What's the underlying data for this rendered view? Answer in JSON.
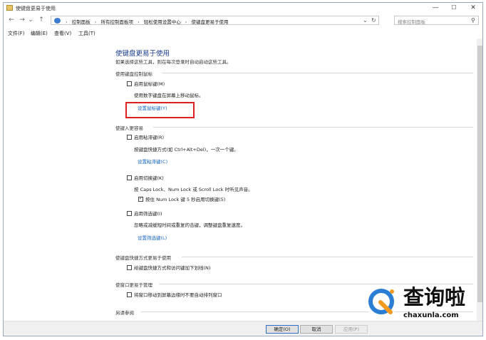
{
  "window": {
    "title": "使键盘更易于使用",
    "minimize_glyph": "—",
    "maximize_glyph": "☐",
    "close_glyph": "✕"
  },
  "nav": {
    "back_glyph": "←",
    "forward_glyph": "→",
    "recent_glyph": "⌄",
    "up_glyph": "↑",
    "breadcrumb": [
      "控制面板",
      "所有控制面板项",
      "轻松使用设置中心",
      "使键盘更易于使用"
    ],
    "crumb_sep": "›",
    "dropdown_glyph": "⌄",
    "refresh_glyph": "↻",
    "search_placeholder": "搜索控制面板",
    "search_glyph": "⚲"
  },
  "menu": [
    "文件(F)",
    "编辑(E)",
    "查看(V)",
    "工具(T)"
  ],
  "page": {
    "title": "使键盘更易于使用",
    "subtitle": "如果选择这些工具，则在每次登录时自动启动这些工具。",
    "mouse_section": {
      "header": "使用键盘控制鼠标",
      "mousekeys_label": "启用鼠标键(M)",
      "mousekeys_desc": "使用数字键盘在屏幕上移动鼠标。",
      "mousekeys_link": "设置鼠标键(Y)"
    },
    "typing_section": {
      "header": "使键入更容易",
      "sticky_label": "启用粘滞键(R)",
      "sticky_desc": "按键盘快捷方式(如 Ctrl+Alt+Del)，一次一个键。",
      "sticky_link": "设置粘滞键(C)",
      "toggle_label": "启用切换键(K)",
      "toggle_desc": "按 Caps Lock、Num Lock 或 Scroll Lock 时听见声音。",
      "toggle_sub_label": "按住 Num Lock 键 5 秒启用切换键(5)",
      "toggle_sub_checked": true,
      "filter_label": "启用筛选键(I)",
      "filter_desc": "忽略或减缓短时间或重复的击键，调整键盘重复速度。",
      "filter_link": "设置筛选键(L)"
    },
    "shortcut_section": {
      "header": "使键盘快捷方式更易于使用",
      "underline_label": "给键盘快捷方式和访问键加下划线(N)"
    },
    "window_section": {
      "header": "使窗口更易于管理",
      "prevent_label": "将窗口移动到屏幕边缘时不要自动排列窗口"
    },
    "see_also": "另请参阅"
  },
  "footer": {
    "ok": "确定(O)",
    "cancel": "取消",
    "apply": "应用(P)"
  },
  "watermark": {
    "brand": "查询啦",
    "url": "chaxunla.com",
    "colors": {
      "blue": "#2a7fd4",
      "orange": "#f29a1f"
    }
  }
}
